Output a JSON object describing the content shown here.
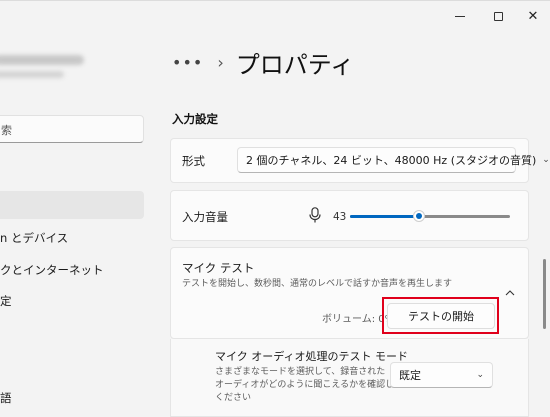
{
  "window": {
    "minimize": "–",
    "maximize": "",
    "close": "✕"
  },
  "sidebar": {
    "search_placeholder": "索",
    "items": [
      {
        "label": "n とデバイス"
      },
      {
        "label": "クとインターネット"
      },
      {
        "label": "定"
      },
      {
        "label": "語"
      }
    ]
  },
  "header": {
    "more": "•••",
    "separator": "›",
    "title": "プロパティ"
  },
  "input_settings": {
    "section_label": "入力設定",
    "format": {
      "label": "形式",
      "value": "2 個のチャネル、24 ビット、48000 Hz (スタジオの音質)"
    },
    "volume": {
      "label": "入力音量",
      "value_text": "43",
      "value": 43,
      "max": 100
    },
    "mic_test": {
      "title": "マイク テスト",
      "description": "テストを開始し、数秒間、通常のレベルで話すか音声を再生します",
      "volume_readout": "ボリューム: 0%",
      "start_button": "テストの開始",
      "collapse_icon": "chevron-up"
    },
    "test_mode": {
      "title": "マイク オーディオ処理のテスト モード",
      "description_line1": "さまざまなモードを選択して、録音された",
      "description_line2": "オーディオがどのように聞こえるかを確認して",
      "description_line3": "ください",
      "value": "既定"
    }
  },
  "colors": {
    "accent": "#0067c0",
    "highlight_border": "#e0001b",
    "background": "#f3f3f3",
    "card": "#fbfbfb"
  }
}
